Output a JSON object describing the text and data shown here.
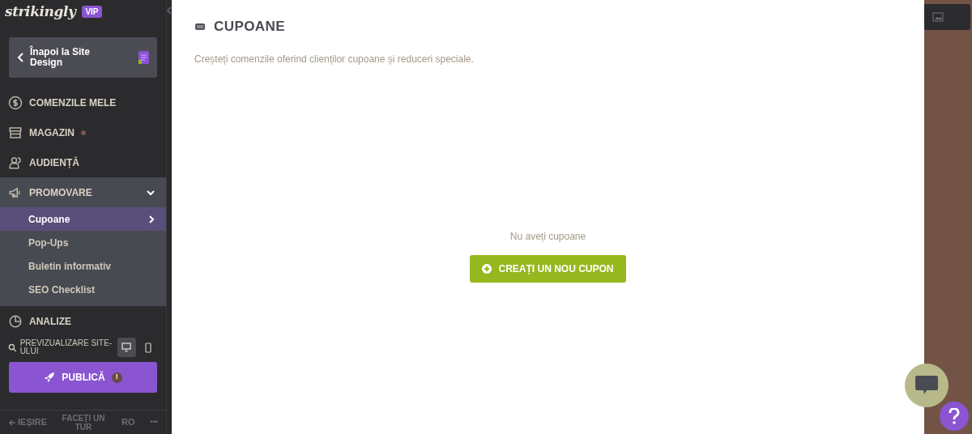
{
  "sidebar": {
    "logo": "strikingly",
    "badge": "VIP",
    "back_button": "Înapoi la Site Design",
    "nav": [
      {
        "label": "COMENZILE MELE",
        "expanded": false
      },
      {
        "label": "MAGAZIN",
        "dot": true,
        "expanded": false
      },
      {
        "label": "AUDIENȚĂ",
        "expanded": false
      },
      {
        "label": "PROMOVARE",
        "expanded": true,
        "children": [
          {
            "label": "Cupoane",
            "selected": true
          },
          {
            "label": "Pop-Ups",
            "selected": false
          },
          {
            "label": "Buletin informativ",
            "selected": false
          },
          {
            "label": "SEO Checklist",
            "selected": false
          }
        ]
      },
      {
        "label": "ANALIZE",
        "expanded": false
      }
    ],
    "preview": {
      "label": "PREVIZUALIZARE SITE-ULUI",
      "devices": [
        {
          "kind": "desktop",
          "selected": true
        },
        {
          "kind": "mobile",
          "selected": false
        }
      ]
    },
    "publish_button": "PUBLICĂ",
    "publish_alert": "!",
    "footer": {
      "exit": "IEȘIRE",
      "tour": "FACEȚI UN TUR",
      "language": "RO",
      "more": "•••"
    }
  },
  "main": {
    "title": "CUPOANE",
    "description": "Creșteți comenzile oferind clienților cupoane și reduceri speciale.",
    "empty_text": "Nu aveți cupoane",
    "create_button": "CREAȚI UN NOU CUPON"
  }
}
